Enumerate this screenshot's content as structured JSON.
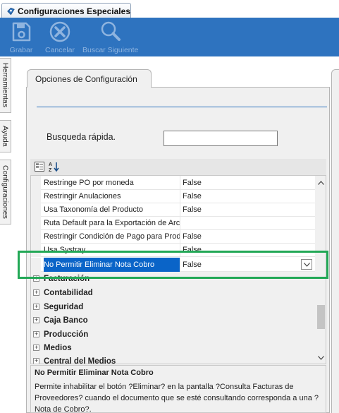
{
  "tab": {
    "title": "Configuraciones Especiales"
  },
  "toolbar": {
    "grabar": "Grabar",
    "cancelar": "Cancelar",
    "buscar": "Buscar Siguiente"
  },
  "side_tabs": [
    "Herramientas",
    "Ayuda",
    "Configuraciones"
  ],
  "panel": {
    "title": "Opciones de Configuración"
  },
  "search": {
    "label": "Busqueda rápida.",
    "value": ""
  },
  "grid": {
    "rows": [
      {
        "name": "Restringe PO por moneda",
        "value": "False"
      },
      {
        "name": "Restringir Anulaciones",
        "value": "False"
      },
      {
        "name": "Usa Taxonomía del Producto",
        "value": "False"
      },
      {
        "name": "Ruta Default para la Exportación de Arc",
        "value": ""
      },
      {
        "name": "Restringir Condición de Pago para Produ",
        "value": "False"
      },
      {
        "name": "Usa Systray",
        "value": "False"
      },
      {
        "name": "No Permitir Eliminar Nota Cobro",
        "value": "False"
      }
    ],
    "categories": [
      "Facturación",
      "Contabilidad",
      "Seguridad",
      "Caja Banco",
      "Producción",
      "Medios",
      "Central del Medios"
    ]
  },
  "description": {
    "title": "No Permitir Eliminar Nota Cobro",
    "text": "Permite inhabilitar el botón ?Eliminar? en la pantalla ?Consulta  Facturas de Proveedores? cuando el documento que se esté consultando corresponda a una ?Nota de Cobro?."
  },
  "colors": {
    "toolbar": "#2e73bf",
    "selection": "#0a64c8",
    "highlight": "#22a856"
  }
}
